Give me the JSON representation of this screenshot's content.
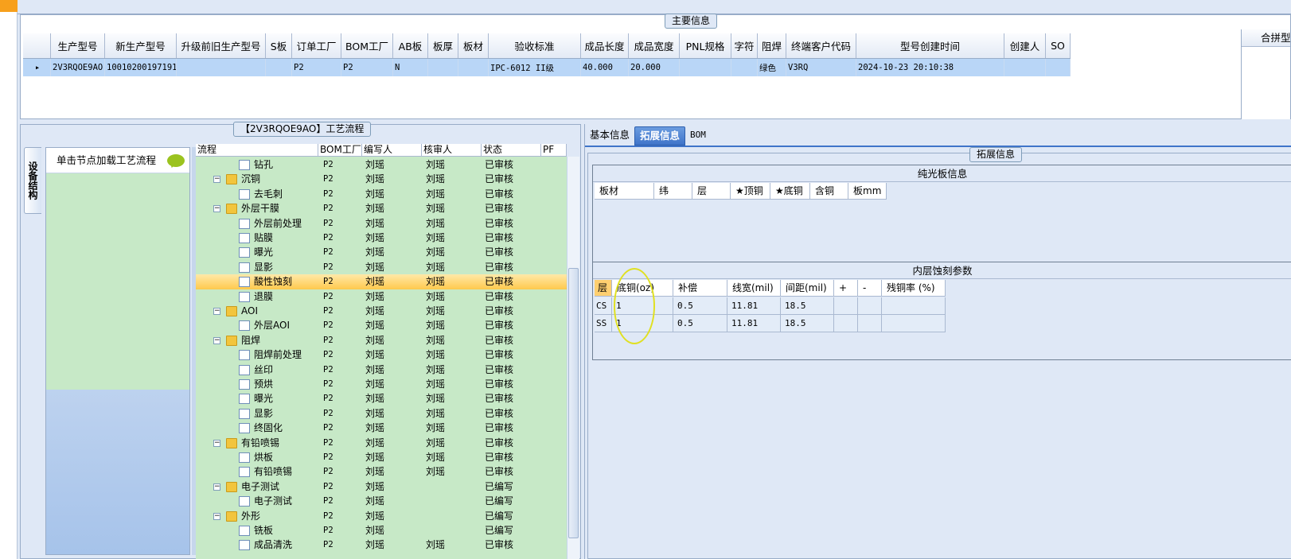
{
  "main_info": {
    "title": "主要信息",
    "columns": [
      "生产型号",
      "新生产型号",
      "升级前旧生产型号",
      "S板",
      "订单工厂",
      "BOM工厂",
      "AB板",
      "板厚",
      "板材",
      "验收标准",
      "成品长度",
      "成品宽度",
      "PNL规格",
      "字符",
      "阻焊",
      "终端客户代码",
      "型号创建时间",
      "创建人",
      "SO"
    ],
    "row": [
      "2V3RQOE9AO",
      "10010200197191",
      "",
      "",
      "P2",
      "P2",
      "N",
      "",
      "",
      "IPC-6012 II级",
      "40.000",
      "20.000",
      "",
      "",
      "绿色",
      "V3RQ",
      "2024-10-23 20:10:38",
      "",
      ""
    ],
    "right_column": "合拼型"
  },
  "process": {
    "title": "【2V3RQOE9AO】工艺流程",
    "side_tab": "设备结构",
    "nav_item": "单击节点加载工艺流程",
    "columns": [
      "流程",
      "BOM工厂",
      "编写人",
      "核审人",
      "状态",
      "PF"
    ],
    "rows": [
      {
        "name": "钻孔",
        "type": "doc",
        "level": 2,
        "bom": "P2",
        "writer": "刘瑶",
        "reviewer": "刘瑶",
        "status": "已审核"
      },
      {
        "name": "沉铜",
        "type": "folder",
        "level": 1,
        "bom": "P2",
        "writer": "刘瑶",
        "reviewer": "刘瑶",
        "status": "已审核"
      },
      {
        "name": "去毛刺",
        "type": "doc",
        "level": 2,
        "bom": "P2",
        "writer": "刘瑶",
        "reviewer": "刘瑶",
        "status": "已审核"
      },
      {
        "name": "外层干膜",
        "type": "folder",
        "level": 1,
        "bom": "P2",
        "writer": "刘瑶",
        "reviewer": "刘瑶",
        "status": "已审核"
      },
      {
        "name": "外层前处理",
        "type": "doc",
        "level": 2,
        "bom": "P2",
        "writer": "刘瑶",
        "reviewer": "刘瑶",
        "status": "已审核"
      },
      {
        "name": "贴膜",
        "type": "doc",
        "level": 2,
        "bom": "P2",
        "writer": "刘瑶",
        "reviewer": "刘瑶",
        "status": "已审核"
      },
      {
        "name": "曝光",
        "type": "doc",
        "level": 2,
        "bom": "P2",
        "writer": "刘瑶",
        "reviewer": "刘瑶",
        "status": "已审核"
      },
      {
        "name": "显影",
        "type": "doc",
        "level": 2,
        "bom": "P2",
        "writer": "刘瑶",
        "reviewer": "刘瑶",
        "status": "已审核"
      },
      {
        "name": "酸性蚀刻",
        "type": "doc",
        "level": 2,
        "bom": "P2",
        "writer": "刘瑶",
        "reviewer": "刘瑶",
        "status": "已审核",
        "selected": true
      },
      {
        "name": "退膜",
        "type": "doc",
        "level": 2,
        "bom": "P2",
        "writer": "刘瑶",
        "reviewer": "刘瑶",
        "status": "已审核"
      },
      {
        "name": "AOI",
        "type": "folder",
        "level": 1,
        "bom": "P2",
        "writer": "刘瑶",
        "reviewer": "刘瑶",
        "status": "已审核"
      },
      {
        "name": "外层AOI",
        "type": "doc",
        "level": 2,
        "bom": "P2",
        "writer": "刘瑶",
        "reviewer": "刘瑶",
        "status": "已审核"
      },
      {
        "name": "阻焊",
        "type": "folder",
        "level": 1,
        "bom": "P2",
        "writer": "刘瑶",
        "reviewer": "刘瑶",
        "status": "已审核"
      },
      {
        "name": "阻焊前处理",
        "type": "doc",
        "level": 2,
        "bom": "P2",
        "writer": "刘瑶",
        "reviewer": "刘瑶",
        "status": "已审核"
      },
      {
        "name": "丝印",
        "type": "doc",
        "level": 2,
        "bom": "P2",
        "writer": "刘瑶",
        "reviewer": "刘瑶",
        "status": "已审核"
      },
      {
        "name": "预烘",
        "type": "doc",
        "level": 2,
        "bom": "P2",
        "writer": "刘瑶",
        "reviewer": "刘瑶",
        "status": "已审核"
      },
      {
        "name": "曝光",
        "type": "doc",
        "level": 2,
        "bom": "P2",
        "writer": "刘瑶",
        "reviewer": "刘瑶",
        "status": "已审核"
      },
      {
        "name": "显影",
        "type": "doc",
        "level": 2,
        "bom": "P2",
        "writer": "刘瑶",
        "reviewer": "刘瑶",
        "status": "已审核"
      },
      {
        "name": "终固化",
        "type": "doc",
        "level": 2,
        "bom": "P2",
        "writer": "刘瑶",
        "reviewer": "刘瑶",
        "status": "已审核"
      },
      {
        "name": "有铅喷锡",
        "type": "folder",
        "level": 1,
        "bom": "P2",
        "writer": "刘瑶",
        "reviewer": "刘瑶",
        "status": "已审核"
      },
      {
        "name": "烘板",
        "type": "doc",
        "level": 2,
        "bom": "P2",
        "writer": "刘瑶",
        "reviewer": "刘瑶",
        "status": "已审核"
      },
      {
        "name": "有铅喷锡",
        "type": "doc",
        "level": 2,
        "bom": "P2",
        "writer": "刘瑶",
        "reviewer": "刘瑶",
        "status": "已审核"
      },
      {
        "name": "电子测试",
        "type": "folder",
        "level": 1,
        "bom": "P2",
        "writer": "刘瑶",
        "reviewer": "",
        "status": "已编写"
      },
      {
        "name": "电子测试",
        "type": "doc",
        "level": 2,
        "bom": "P2",
        "writer": "刘瑶",
        "reviewer": "",
        "status": "已编写"
      },
      {
        "name": "外形",
        "type": "folder",
        "level": 1,
        "bom": "P2",
        "writer": "刘瑶",
        "reviewer": "",
        "status": "已编写"
      },
      {
        "name": "铣板",
        "type": "doc",
        "level": 2,
        "bom": "P2",
        "writer": "刘瑶",
        "reviewer": "",
        "status": "已编写"
      },
      {
        "name": "成品清洗",
        "type": "doc",
        "level": 2,
        "bom": "P2",
        "writer": "刘瑶",
        "reviewer": "刘瑶",
        "status": "已审核"
      }
    ]
  },
  "tabs": [
    "基本信息",
    "拓展信息",
    "BOM"
  ],
  "extend": {
    "title": "拓展信息",
    "plain_title": "纯光板信息",
    "plain_columns": [
      "板材",
      "纬",
      "层",
      "★顶铜",
      "★底铜",
      "含铜",
      "板mm"
    ],
    "etch_title": "内层蚀刻参数",
    "etch_columns": [
      "层",
      "底铜(oz)",
      "补偿",
      "线宽(mil)",
      "间距(mil)",
      "+",
      "-",
      "残铜率 (%)"
    ],
    "etch_rows": [
      [
        "CS",
        "1",
        "0.5",
        "11.81",
        "18.5",
        "",
        "",
        ""
      ],
      [
        "SS",
        "1",
        "0.5",
        "11.81",
        "18.5",
        "",
        "",
        ""
      ]
    ]
  },
  "colors": {
    "selected_row": "#b9d6f7",
    "tree_bg": "#c7e9c7",
    "active_tab": "#3f74c9",
    "highlight_ellipse": "#e0e022"
  }
}
